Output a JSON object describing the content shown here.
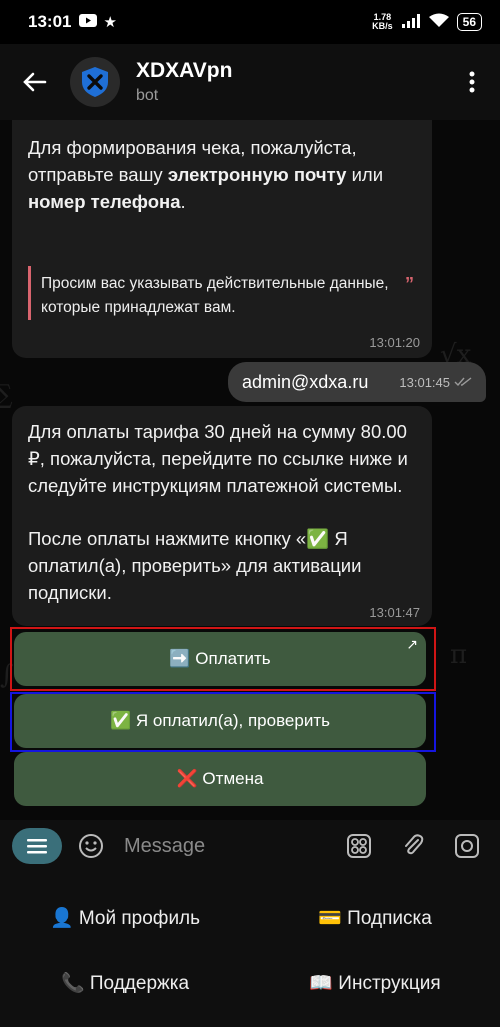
{
  "status_bar": {
    "time": "13:01",
    "network_speed": "1.78",
    "network_unit": "KB/s",
    "battery": "56"
  },
  "header": {
    "name": "XDXAVpn",
    "subtitle": "bot"
  },
  "messages": {
    "receipt_text_1": "Для формирования чека, пожалуйста, отправьте вашу ",
    "receipt_bold": "электронную почту",
    "receipt_text_2": " или ",
    "receipt_bold_2": "номер телефона",
    "receipt_text_3": ".",
    "quote": "Просим вас указывать действительные данные, которые принадлежат вам.",
    "receipt_time": "13:01:20",
    "user_email": "admin@xdxa.ru",
    "user_time": "13:01:45",
    "payment_text": "Для оплаты тарифа 30 дней на сумму 80.00 ₽, пожалуйста, перейдите по ссылке ниже и следуйте инструкциям платежной системы.",
    "payment_text_2": "После оплаты нажмите кнопку «✅ Я оплатил(а), проверить» для активации подписки.",
    "payment_time": "13:01:47"
  },
  "inline_buttons": {
    "pay": "➡️ Оплатить",
    "paid": "✅ Я оплатил(а), проверить",
    "cancel": "❌ Отмена"
  },
  "composer": {
    "placeholder": "Message"
  },
  "keyboard": {
    "profile": "👤 Мой профиль",
    "subscription": "💳 Подписка",
    "support": "📞 Поддержка",
    "instructions": "📖 Инструкция"
  }
}
